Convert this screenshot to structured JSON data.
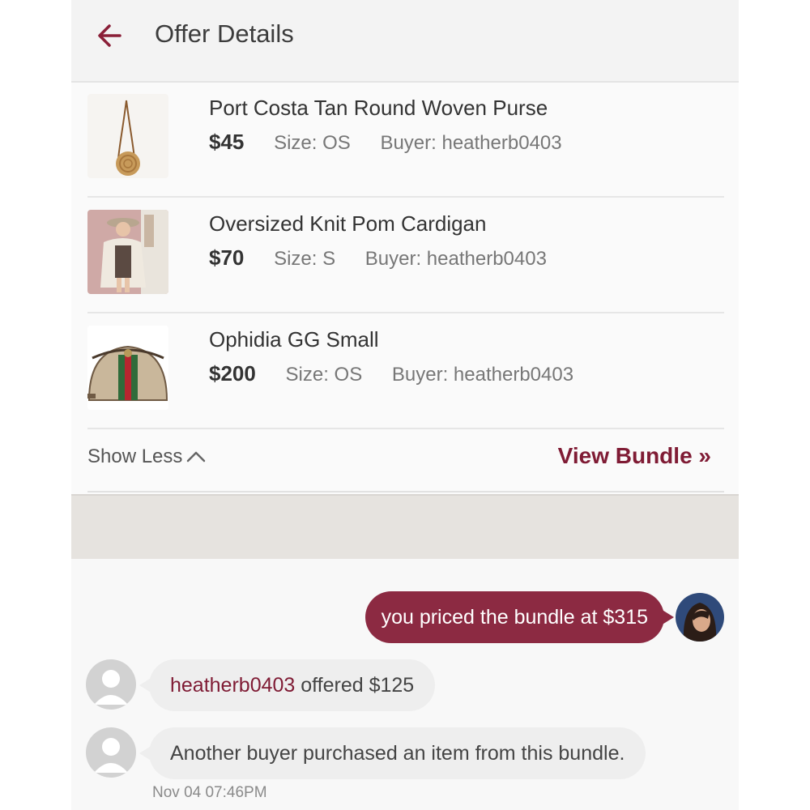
{
  "header": {
    "title": "Offer Details",
    "back_icon": "arrow-left-icon",
    "accent_color": "#8a1f38"
  },
  "items": [
    {
      "title": "Port Costa Tan Round Woven Purse",
      "price": "$45",
      "size": "Size: OS",
      "buyer": "Buyer: heatherb0403",
      "thumb_icon": "round-woven-purse-thumbnail"
    },
    {
      "title": "Oversized Knit Pom Cardigan",
      "price": "$70",
      "size": "Size: S",
      "buyer": "Buyer: heatherb0403",
      "thumb_icon": "cardigan-model-thumbnail"
    },
    {
      "title": "Ophidia GG Small",
      "price": "$200",
      "size": "Size: OS",
      "buyer": "Buyer: heatherb0403",
      "thumb_icon": "gg-handbag-thumbnail"
    }
  ],
  "actions": {
    "show_less": "Show Less",
    "show_less_icon": "chevron-up-icon",
    "view_bundle": "View Bundle »"
  },
  "chat": {
    "messages": [
      {
        "from": "me",
        "text": "you priced the bundle at $315",
        "color": "#8c2a42"
      },
      {
        "from": "system",
        "user": "heatherb0403",
        "text": " offered $125"
      },
      {
        "from": "system",
        "text": "Another buyer purchased an item from this bundle."
      }
    ],
    "timestamp": "Nov 04 07:46PM"
  }
}
